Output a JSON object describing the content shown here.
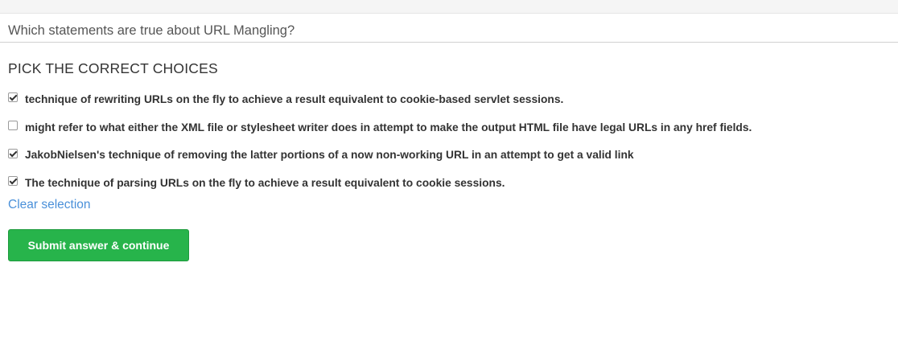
{
  "question": "Which statements are true about URL Mangling?",
  "instructions": "PICK THE CORRECT CHOICES",
  "choices": [
    {
      "label": "technique of rewriting URLs on the fly to achieve a result equivalent to cookie-based servlet sessions.",
      "checked": true
    },
    {
      "label": "might refer to what either the XML file or stylesheet writer does in attempt to make the output HTML file have legal URLs in any href fields.",
      "checked": false
    },
    {
      "label": "JakobNielsen's technique of removing the latter portions of a now non-working URL in an attempt to get a valid link",
      "checked": true
    },
    {
      "label": "The technique of parsing URLs on the fly to achieve a result equivalent to cookie sessions.",
      "checked": true
    }
  ],
  "clear_label": "Clear selection",
  "submit_label": "Submit answer & continue",
  "colors": {
    "submit": "#27b44b",
    "link": "#4a90d9"
  }
}
